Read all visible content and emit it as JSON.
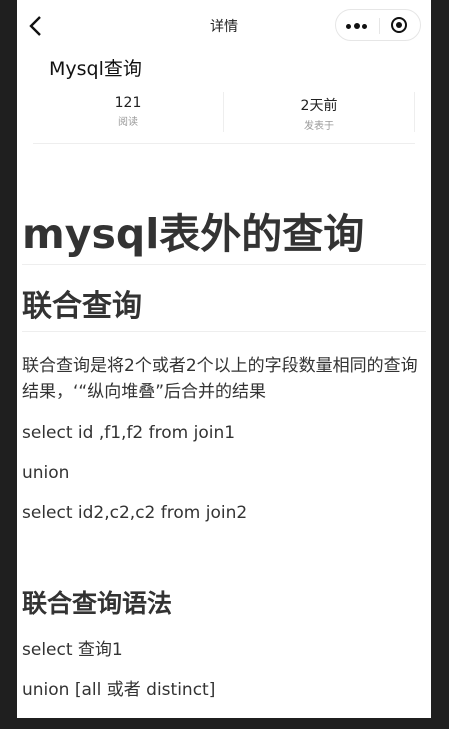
{
  "nav": {
    "title": "详情",
    "back_icon": "back-arrow-icon",
    "more_icon": "more-icon",
    "close_icon": "target-icon"
  },
  "post": {
    "title": "Mysql查询",
    "stats": [
      {
        "value": "121",
        "label": "阅读"
      },
      {
        "value": "2天前",
        "label": "发表于"
      }
    ]
  },
  "article": {
    "h1": "mysql表外的查询",
    "h2": "联合查询",
    "intro": "联合查询是将2个或者2个以上的字段数量相同的查询结果，‘“纵向堆叠”后合并的结果",
    "code_line_1": "select id ,f1,f2 from join1",
    "code_line_2": "union",
    "code_line_3": "select id2,c2,c2 from join2",
    "h3": "联合查询语法",
    "syntax_line_1": "select 查询1",
    "syntax_line_2": "union [all 或者 distinct]"
  }
}
